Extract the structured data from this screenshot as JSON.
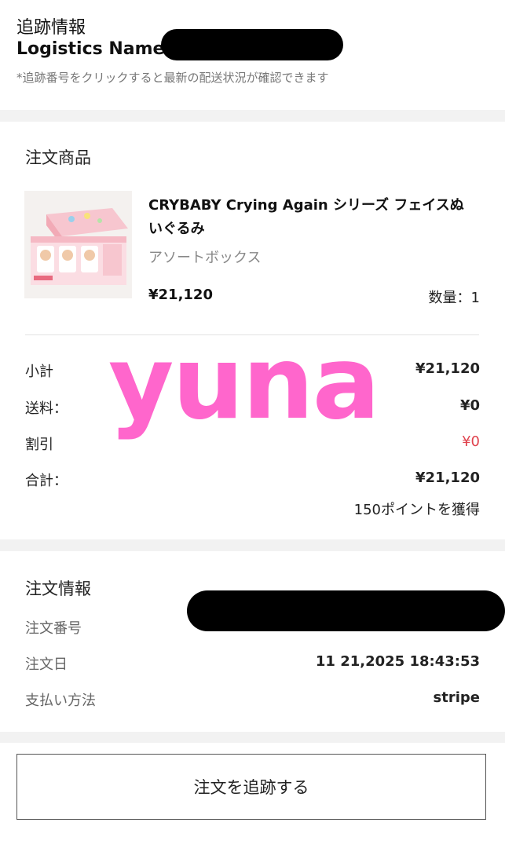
{
  "tracking": {
    "title": "追跡情報",
    "logistics_label": "Logistics Name:",
    "logistics_value_visible": "S",
    "note": "*追跡番号をクリックすると最新の配送状況が確認できます"
  },
  "items": {
    "section_title": "注文商品",
    "product": {
      "name": "CRYBABY Crying Again シリーズ フェイスぬいぐるみ",
      "variant": "アソートボックス",
      "price": "¥21,120",
      "quantity": "数量：1"
    },
    "summary": {
      "subtotal_label": "小計",
      "subtotal_value": "¥21,120",
      "shipping_label": "送料：",
      "shipping_value": "¥0",
      "discount_label": "割引",
      "discount_value": "¥0",
      "total_label": "合計：",
      "total_value": "¥21,120",
      "points": "150ポイントを獲得"
    },
    "watermark": "yuna"
  },
  "order_info": {
    "section_title": "注文情報",
    "number_label": "注文番号",
    "date_label": "注文日",
    "date_value": "11 21,2025 18:43:53",
    "payment_label": "支払い方法",
    "payment_value": "stripe"
  },
  "footer": {
    "track_button_label": "注文を追跡する"
  },
  "colors": {
    "background": "#f2f2f2",
    "discount": "#e0424d",
    "link": "#3a8fd9",
    "watermark": "#ff66cc"
  }
}
